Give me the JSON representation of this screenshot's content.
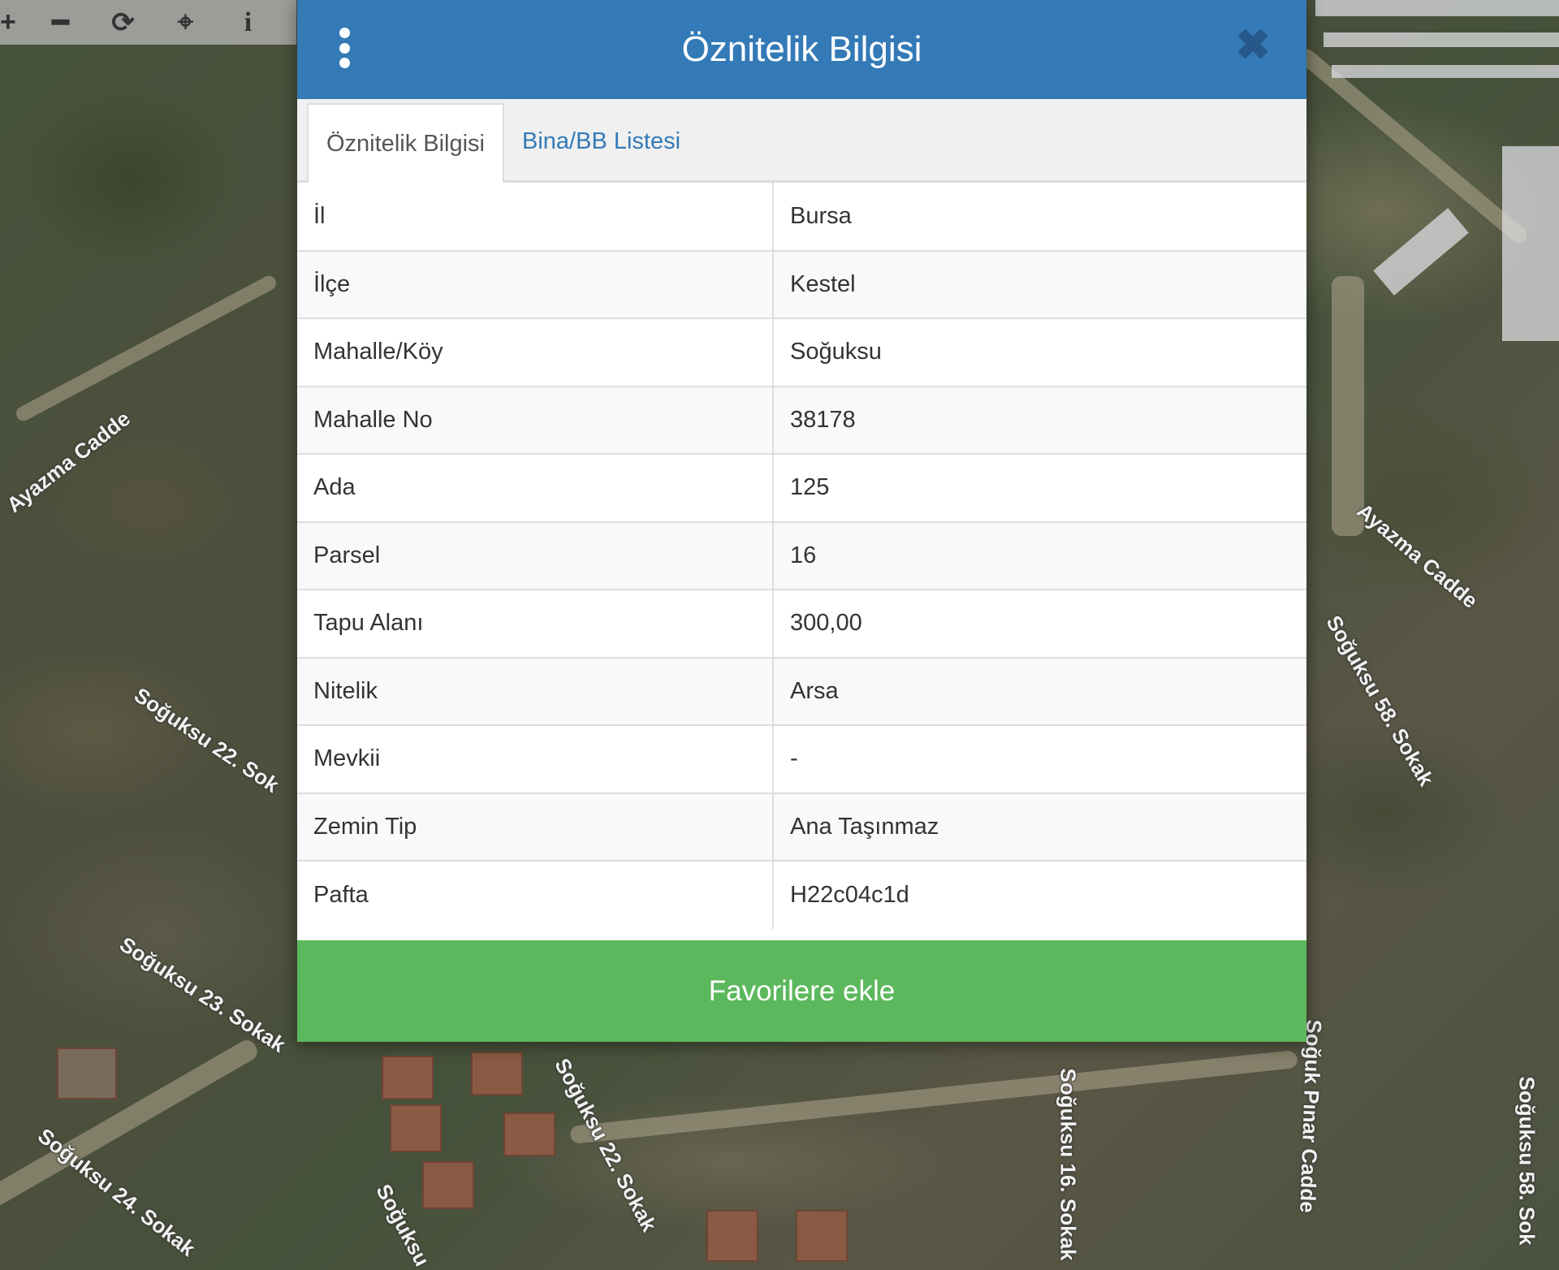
{
  "map": {
    "street_labels": [
      "Ayazma Cadde",
      "Soğuksu 22. Sok",
      "Soğuksu 23. Sokak",
      "Soğuksu 24. Sokak",
      "Soğuksu 22. Sokak",
      "Soğuksu",
      "Soğuksu 16. Sokak",
      "Soğuk Pınar Cadde",
      "Ayazma Cadde",
      "Soğuksu 58. Sokak",
      "Soğuksu 58. Sok"
    ]
  },
  "toolbar": {
    "items": [
      {
        "name": "zoom-in-icon",
        "glyph": "+"
      },
      {
        "name": "zoom-out-icon",
        "glyph": "━"
      },
      {
        "name": "refresh-icon",
        "glyph": "⟳"
      },
      {
        "name": "locate-icon",
        "glyph": "⌖"
      },
      {
        "name": "info-icon",
        "glyph": "i"
      }
    ]
  },
  "dialog": {
    "title": "Öznitelik Bilgisi",
    "close_glyph": "✖",
    "tabs": [
      {
        "label": "Öznitelik Bilgisi",
        "active": true
      },
      {
        "label": "Bina/BB Listesi",
        "active": false
      }
    ],
    "rows": [
      {
        "key": "İl",
        "value": "Bursa"
      },
      {
        "key": "İlçe",
        "value": "Kestel"
      },
      {
        "key": "Mahalle/Köy",
        "value": "Soğuksu"
      },
      {
        "key": "Mahalle No",
        "value": "38178"
      },
      {
        "key": "Ada",
        "value": "125"
      },
      {
        "key": "Parsel",
        "value": "16"
      },
      {
        "key": "Tapu Alanı",
        "value": "300,00"
      },
      {
        "key": "Nitelik",
        "value": "Arsa"
      },
      {
        "key": "Mevkii",
        "value": "-"
      },
      {
        "key": "Zemin Tip",
        "value": "Ana Taşınmaz"
      },
      {
        "key": "Pafta",
        "value": "H22c04c1d"
      }
    ],
    "favorite_button_label": "Favorilere ekle"
  },
  "colors": {
    "header": "#337ab7",
    "favorite_button": "#5cb85c",
    "tab_link": "#337ab7"
  }
}
